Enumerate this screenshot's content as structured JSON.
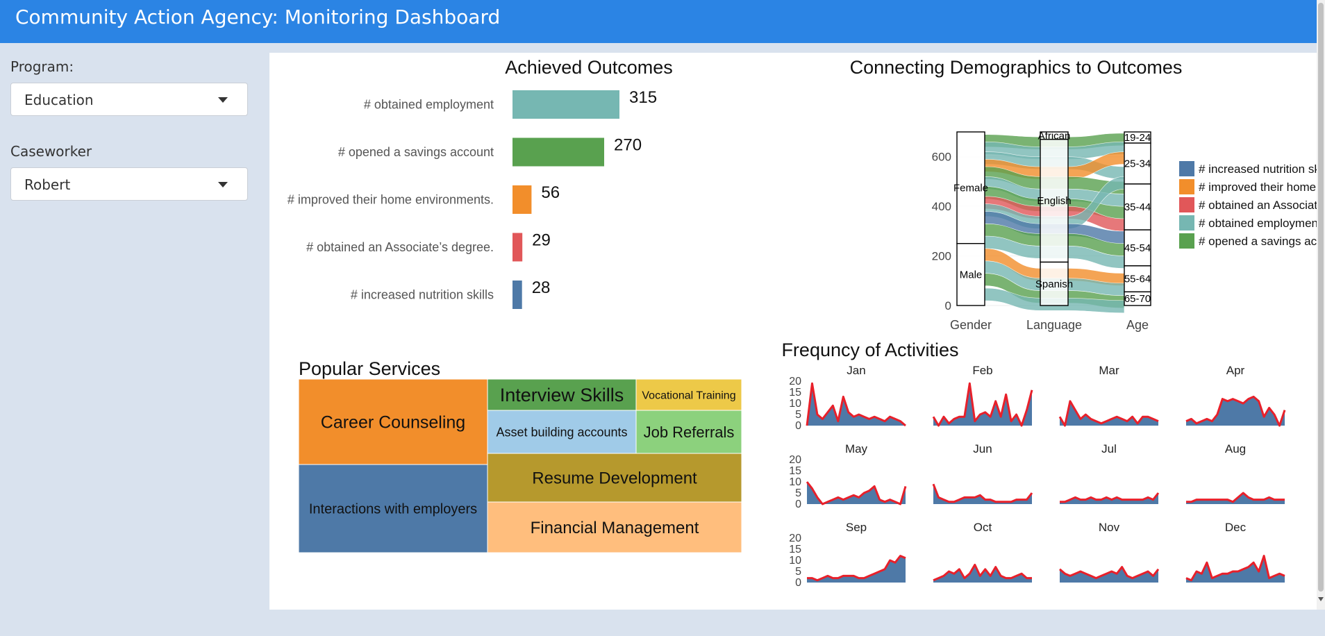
{
  "header": {
    "title": "Community Action Agency: Monitoring Dashboard"
  },
  "sidebar": {
    "program": {
      "label": "Program:",
      "value": "Education"
    },
    "caseworker": {
      "label": "Caseworker",
      "value": "Robert"
    }
  },
  "colors": {
    "header": "#2b84e4",
    "sidebar": "#d9e2ee",
    "blue": "#4e79a7",
    "orange": "#f28e2b",
    "red": "#e15759",
    "teal": "#76b7b2",
    "green": "#59a14f",
    "olive": "#b6992d",
    "yellow": "#edc948",
    "lightgreen": "#8cd17d",
    "lightblue": "#a0cbe8",
    "peach": "#ffbe7d",
    "activity_line": "#e8202a"
  },
  "chart_data": [
    {
      "type": "bar",
      "orientation": "horizontal",
      "title": "Achieved Outcomes",
      "categories": [
        "# obtained employment",
        "# opened a savings account",
        "# improved their home environments.",
        "# obtained an Associate’s degree.",
        "#  increased nutrition skills"
      ],
      "values": [
        315,
        270,
        56,
        29,
        28
      ],
      "colors": [
        "#76b7b2",
        "#59a14f",
        "#f28e2b",
        "#e15759",
        "#4e79a7"
      ]
    },
    {
      "type": "treemap",
      "title": "Popular Services",
      "items": [
        {
          "label": "Career Counseling",
          "color": "#f28e2b"
        },
        {
          "label": "Interactions with employers",
          "color": "#4e79a7"
        },
        {
          "label": "Interview Skills",
          "color": "#59a14f"
        },
        {
          "label": "Vocational Training",
          "color": "#edc948"
        },
        {
          "label": "Asset building accounts",
          "color": "#a0cbe8"
        },
        {
          "label": "Job Referrals",
          "color": "#8cd17d"
        },
        {
          "label": "Resume Development",
          "color": "#b6992d"
        },
        {
          "label": "Financial Management",
          "color": "#ffbe7d"
        }
      ]
    },
    {
      "type": "alluvial",
      "title": "Connecting Demographics to Outcomes",
      "axes": [
        "Gender",
        "Language",
        "Age"
      ],
      "ylim": [
        0,
        700
      ],
      "yticks": [
        0,
        200,
        400,
        600
      ],
      "strata": {
        "Gender": [
          {
            "label": "Female",
            "from": 250,
            "to": 700
          },
          {
            "label": "Male",
            "from": 0,
            "to": 250
          }
        ],
        "Language": [
          {
            "label": "African",
            "from": 670,
            "to": 700
          },
          {
            "label": "English",
            "from": 175,
            "to": 670
          },
          {
            "label": "Spanish",
            "from": 0,
            "to": 175
          }
        ],
        "Age": [
          {
            "label": "19-24",
            "from": 655,
            "to": 700
          },
          {
            "label": "25-34",
            "from": 490,
            "to": 655
          },
          {
            "label": "35-44",
            "from": 305,
            "to": 490
          },
          {
            "label": "45-54",
            "from": 160,
            "to": 305
          },
          {
            "label": "55-64",
            "from": 55,
            "to": 160
          },
          {
            "label": "65-70",
            "from": 0,
            "to": 55
          }
        ]
      },
      "legend": [
        {
          "label": "#  increased nutrition skills",
          "color": "#4e79a7"
        },
        {
          "label": "# improved their home environments",
          "color": "#f28e2b"
        },
        {
          "label": "# obtained an Associate’s degree.",
          "color": "#e15759"
        },
        {
          "label": "# obtained employment",
          "color": "#76b7b2"
        },
        {
          "label": "# opened a savings account",
          "color": "#59a14f"
        }
      ]
    },
    {
      "type": "area",
      "title": "Frequncy of Activities",
      "ylim": [
        0,
        20
      ],
      "yticks": [
        0,
        5,
        10,
        15,
        20
      ],
      "panels": [
        {
          "month": "Jan",
          "values": [
            0,
            19,
            5,
            3,
            6,
            9,
            2,
            13,
            6,
            4,
            5,
            4,
            3,
            4,
            3,
            2,
            4,
            3,
            2,
            0
          ]
        },
        {
          "month": "Feb",
          "values": [
            4,
            0,
            4,
            1,
            3,
            4,
            4,
            19,
            2,
            5,
            6,
            4,
            11,
            4,
            14,
            2,
            5,
            0,
            7,
            16
          ]
        },
        {
          "month": "Mar",
          "values": [
            4,
            0,
            11,
            7,
            3,
            5,
            3,
            2,
            1,
            2,
            3,
            4,
            3,
            2,
            4,
            1,
            4,
            4,
            3,
            2
          ]
        },
        {
          "month": "Apr",
          "values": [
            2,
            3,
            1,
            2,
            3,
            2,
            5,
            12,
            11,
            12,
            11,
            10,
            12,
            13,
            11,
            4,
            8,
            5,
            0,
            7
          ]
        },
        {
          "month": "May",
          "values": [
            10,
            7,
            3,
            0,
            1,
            2,
            3,
            2,
            3,
            4,
            3,
            5,
            6,
            8,
            2,
            1,
            2,
            1,
            0,
            8
          ]
        },
        {
          "month": "Jun",
          "values": [
            9,
            3,
            2,
            1,
            1,
            2,
            3,
            3,
            3,
            4,
            2,
            2,
            1,
            1,
            1,
            1,
            2,
            2,
            2,
            5
          ]
        },
        {
          "month": "Jul",
          "values": [
            1,
            1,
            2,
            3,
            2,
            2,
            3,
            2,
            2,
            3,
            2,
            3,
            2,
            2,
            2,
            2,
            2,
            3,
            2,
            5
          ]
        },
        {
          "month": "Aug",
          "values": [
            1,
            1,
            2,
            2,
            2,
            2,
            2,
            2,
            2,
            1,
            3,
            5,
            3,
            2,
            2,
            2,
            3,
            2,
            2,
            2
          ]
        },
        {
          "month": "Sep",
          "values": [
            2,
            2,
            1,
            2,
            3,
            2,
            2,
            3,
            3,
            3,
            2,
            2,
            3,
            4,
            5,
            6,
            10,
            9,
            12,
            11
          ]
        },
        {
          "month": "Oct",
          "values": [
            1,
            2,
            3,
            5,
            4,
            6,
            2,
            4,
            8,
            3,
            6,
            3,
            7,
            3,
            2,
            2,
            3,
            4,
            2,
            2
          ]
        },
        {
          "month": "Nov",
          "values": [
            6,
            4,
            3,
            4,
            5,
            4,
            3,
            2,
            3,
            4,
            5,
            4,
            7,
            3,
            2,
            3,
            4,
            5,
            3,
            6
          ]
        },
        {
          "month": "Dec",
          "values": [
            2,
            1,
            5,
            4,
            9,
            2,
            3,
            4,
            4,
            5,
            5,
            6,
            7,
            9,
            5,
            12,
            2,
            3,
            4,
            3
          ]
        }
      ]
    }
  ]
}
